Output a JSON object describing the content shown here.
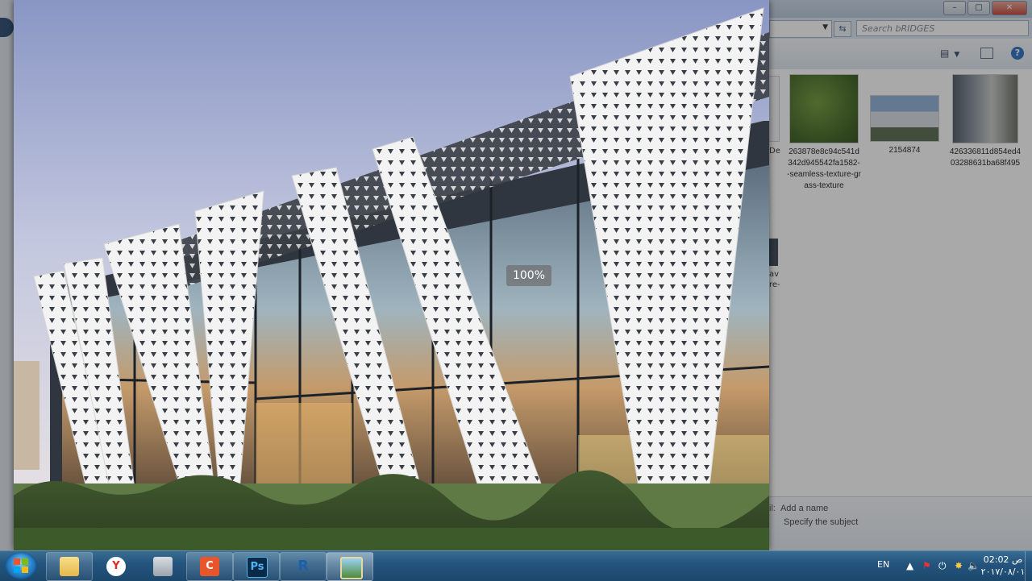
{
  "explorer": {
    "search_placeholder": "Search bRIDGES",
    "help_label": "?",
    "files": [
      {
        "name": "263878e8c94c541d342d945542fa1582--seamless-texture-grass-texture",
        "thumb": "grass"
      },
      {
        "name": "2154874",
        "thumb": "building-white"
      },
      {
        "name": "426336811d854ed403288631ba68f495",
        "thumb": "building-grey"
      }
    ],
    "partial_label": "De",
    "partial_label2": "av\nre-",
    "details": {
      "authors_label": "il:",
      "authors_value": "Add a name",
      "subject_value": "Specify the subject"
    }
  },
  "viewer": {
    "zoom_label": "100%"
  },
  "taskbar": {
    "apps": [
      {
        "name": "explorer",
        "icon": "folder-icon",
        "label": ""
      },
      {
        "name": "yandex",
        "icon": "yandex-browser-icon",
        "label": "Y"
      },
      {
        "name": "calculator",
        "icon": "calculator-icon",
        "label": ""
      },
      {
        "name": "camtasia",
        "icon": "camtasia-icon",
        "label": "C"
      },
      {
        "name": "photoshop",
        "icon": "photoshop-icon",
        "label": "Ps"
      },
      {
        "name": "revit",
        "icon": "revit-icon",
        "label": "R"
      },
      {
        "name": "photo-viewer",
        "icon": "photo-viewer-icon",
        "label": ""
      }
    ],
    "language": "EN",
    "time": "02:02 ص",
    "date": "٢٠١٧/٠٨/٠١"
  },
  "colors": {
    "taskbar": "#24557e",
    "sky_top": "#8d9bc8",
    "sky_bottom": "#e9e3e4",
    "panel": "#f2f2f2",
    "hedge": "#4f6b3a"
  }
}
